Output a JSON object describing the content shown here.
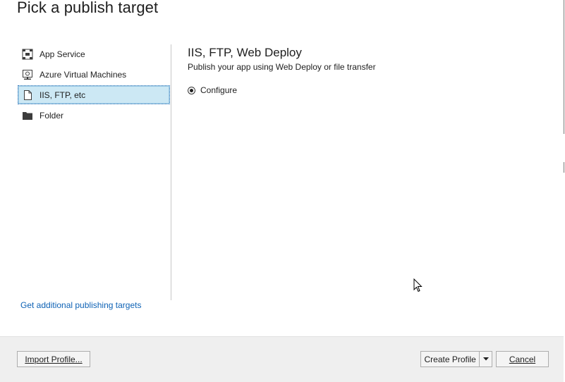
{
  "dialog": {
    "title": "Pick a publish target"
  },
  "targets": [
    {
      "label": "App Service",
      "icon": "app-service-icon",
      "selected": false
    },
    {
      "label": "Azure Virtual Machines",
      "icon": "virtual-machine-icon",
      "selected": false
    },
    {
      "label": "IIS, FTP, etc",
      "icon": "document-icon",
      "selected": true
    },
    {
      "label": "Folder",
      "icon": "folder-icon",
      "selected": false
    }
  ],
  "additional_link": "Get additional publishing targets",
  "detail": {
    "title": "IIS, FTP, Web Deploy",
    "subtitle": "Publish your app using Web Deploy or file transfer",
    "option_label": "Configure",
    "option_selected": true
  },
  "footer": {
    "import_label": "Import Profile...",
    "create_label": "Create Profile",
    "cancel_label": "Cancel"
  },
  "colors": {
    "selected_bg": "#cce8f4",
    "link": "#0e62b5",
    "footer_bg": "#efefef"
  }
}
